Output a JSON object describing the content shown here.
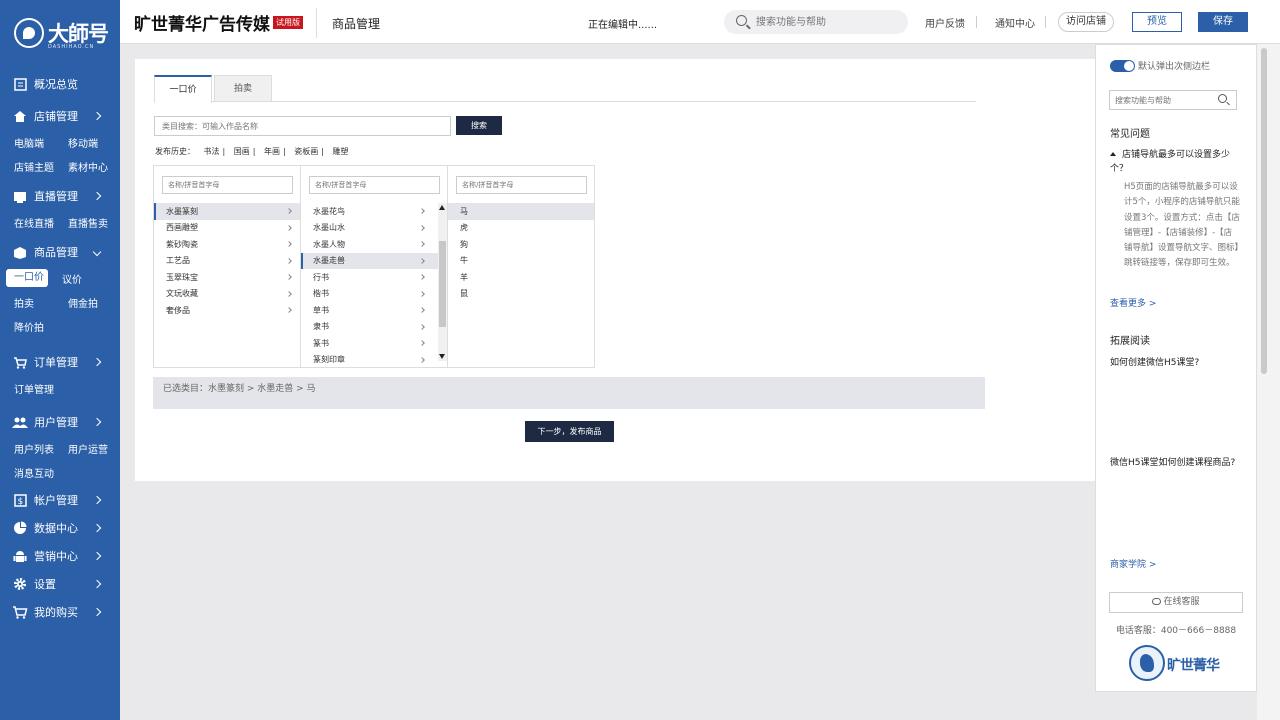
{
  "sidebar": {
    "logo_text": "大師号",
    "logo_sub": "DASHIHAO.CN",
    "overview": "概况总览",
    "store_mgmt": "店铺管理",
    "store_sub": [
      "电脑端",
      "移动端",
      "店铺主题",
      "素材中心"
    ],
    "live_mgmt": "直播管理",
    "live_sub": [
      "在线直播",
      "直播售卖"
    ],
    "goods_mgmt": "商品管理",
    "goods_sub": [
      "一口价",
      "议价",
      "拍卖",
      "佣金拍",
      "降价拍"
    ],
    "order_mgmt": "订单管理",
    "order_sub": [
      "订单管理"
    ],
    "user_mgmt": "用户管理",
    "user_sub": [
      "用户列表",
      "用户运营",
      "消息互动"
    ],
    "account_mgmt": "帐户管理",
    "data_center": "数据中心",
    "marketing": "营销中心",
    "settings": "设置",
    "my_purchase": "我的购买"
  },
  "header": {
    "brand": "旷世菁华广告传媒",
    "trial_badge": "试用版",
    "page_title": "商品管理",
    "editing_status": "正在编辑中......",
    "search_placeholder": "搜索功能与帮助",
    "feedback": "用户反馈",
    "notifications": "通知中心",
    "visit_store": "访问店铺",
    "preview": "预览",
    "save": "保存"
  },
  "main": {
    "tabs": [
      "一口价",
      "拍卖"
    ],
    "category_search_placeholder": "类目搜索：可输入作品名称",
    "search_button": "搜索",
    "history_label": "发布历史：",
    "history_items": [
      "书法",
      "国画",
      "年画",
      "瓷板画",
      "雕塑"
    ],
    "col_filter_placeholder": "名称/拼音首字母",
    "col1": [
      "水墨篆刻",
      "西画雕塑",
      "紫砂陶瓷",
      "工艺品",
      "玉翠珠宝",
      "文玩收藏",
      "奢侈品"
    ],
    "col2": [
      "水墨花鸟",
      "水墨山水",
      "水墨人物",
      "水墨走兽",
      "行书",
      "楷书",
      "草书",
      "隶书",
      "篆书",
      "篆刻印章"
    ],
    "col3": [
      "马",
      "虎",
      "狗",
      "牛",
      "羊",
      "鼠"
    ],
    "selected_path": "已选类目：水墨篆刻 > 水墨走兽 > 马",
    "next_button": "下一步，发布商品"
  },
  "help": {
    "toggle_label": "默认弹出次侧边栏",
    "search_placeholder": "搜索功能与帮助",
    "faq_title": "常见问题",
    "faq_question": "店铺导航最多可以设置多少个？",
    "faq_answer": "H5页面的店铺导航最多可以设计5个，小程序的店铺导航只能设置3个。设置方式：点击【店铺管理】-【店铺装修】-【店铺导航】设置导航文字、图标】跳转链接等，保存即可生效。",
    "more_link": "查看更多 >",
    "reading_title": "拓展阅读",
    "reading_1": "如何创建微信H5课堂?",
    "reading_2": "微信H5课堂如何创建课程商品?",
    "academy_link": "商家学院 >",
    "online_cs": "在线客服",
    "phone": "电话客服：400－666－8888",
    "brand_text": "旷世菁华"
  }
}
